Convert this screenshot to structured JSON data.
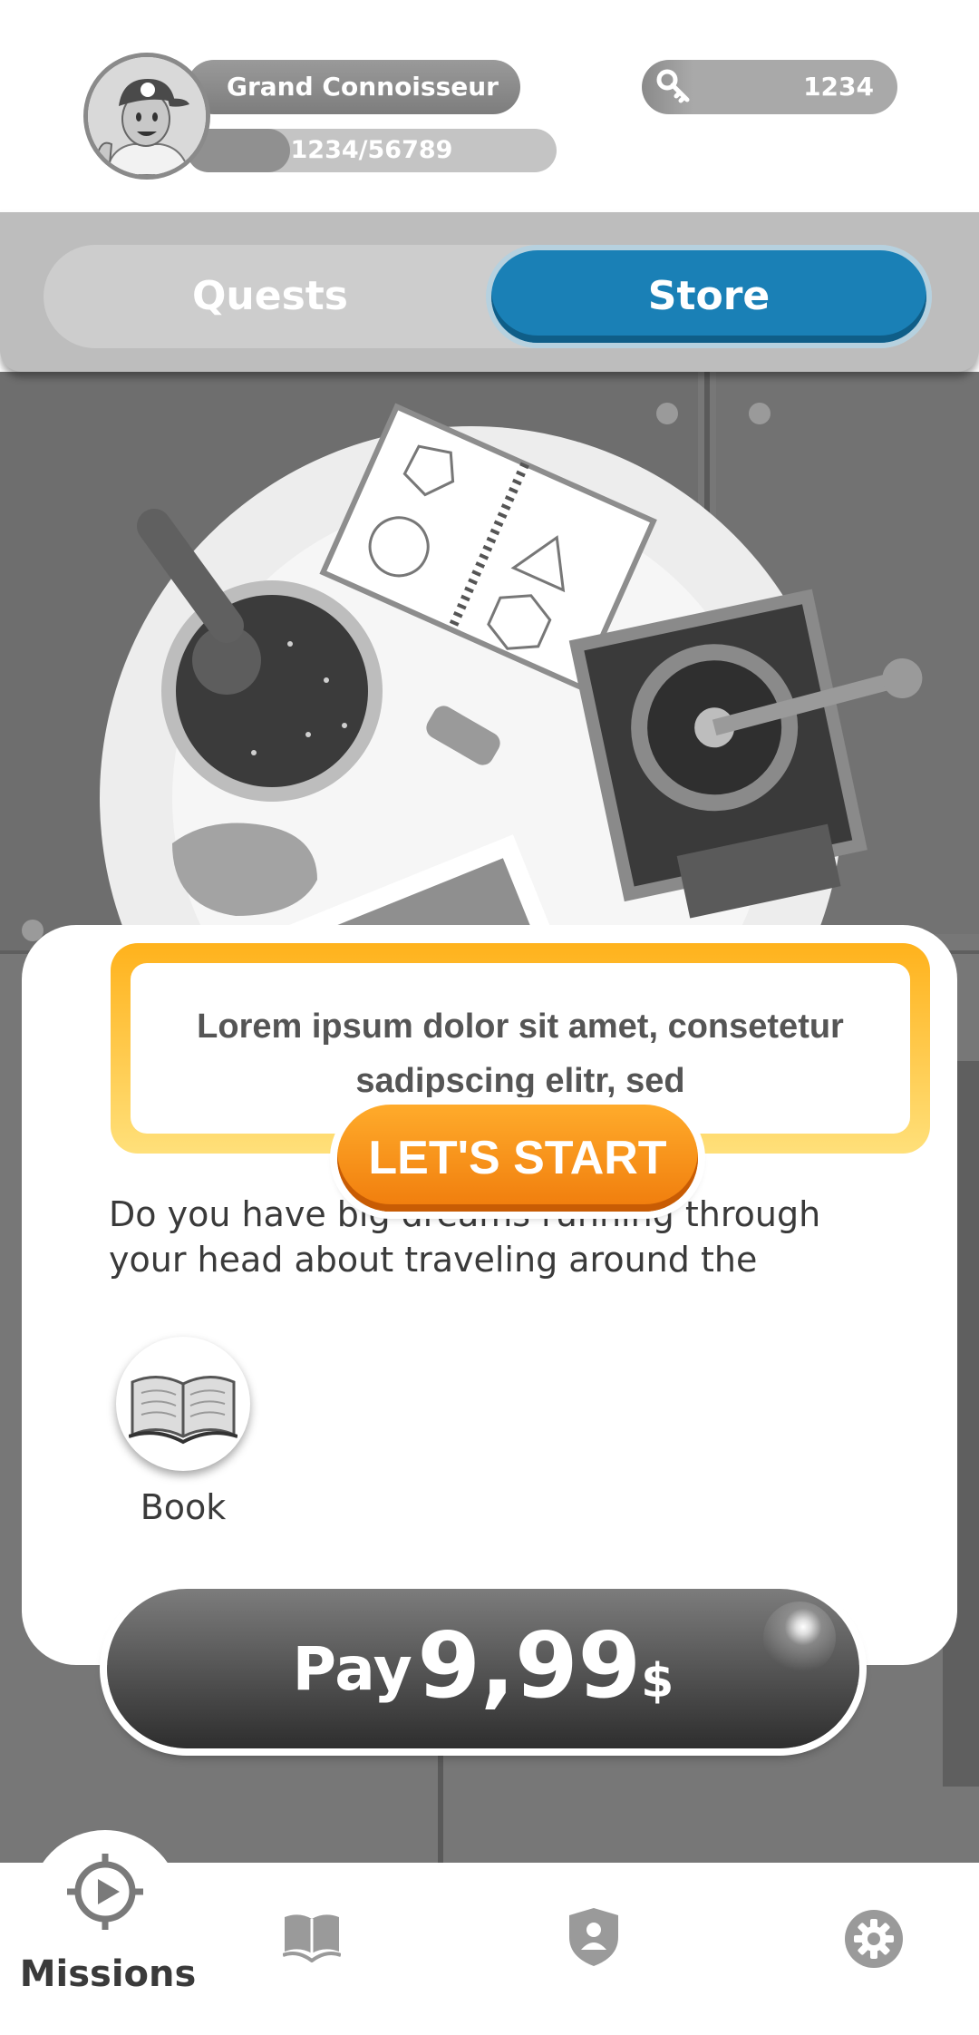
{
  "header": {
    "rank_title": "Grand Connoisseur",
    "xp_text": "1234/56789",
    "xp_progress": 0.28,
    "keys_count": "1234",
    "avatar_icon": "player-avatar-icon",
    "keys_icon": "key-icon"
  },
  "tabs": {
    "items": [
      {
        "label": "Quests",
        "active": false
      },
      {
        "label": "Store",
        "active": true
      }
    ],
    "active_color": "#1a80b6"
  },
  "mission": {
    "banner_text": "Lorem ipsum dolor sit amet, consetetur sadipscing elitr, sed",
    "start_label": "LET'S START",
    "description": "Do you have big dreams running through your head about traveling around the",
    "reward_item_label": "Book",
    "reward_item_icon": "book-icon"
  },
  "purchase": {
    "word": "Pay",
    "amount": "9,99",
    "currency": "$"
  },
  "nav": {
    "items": [
      {
        "label": "Missions",
        "icon": "compass-play-icon",
        "active": true
      },
      {
        "label": "",
        "icon": "book-nav-icon",
        "active": false
      },
      {
        "label": "",
        "icon": "shield-user-icon",
        "active": false
      },
      {
        "label": "",
        "icon": "gear-icon",
        "active": false
      }
    ]
  },
  "colors": {
    "accent_orange": "#f5921a",
    "banner_gold": "#ffb21c",
    "store_blue": "#1a80b6"
  }
}
